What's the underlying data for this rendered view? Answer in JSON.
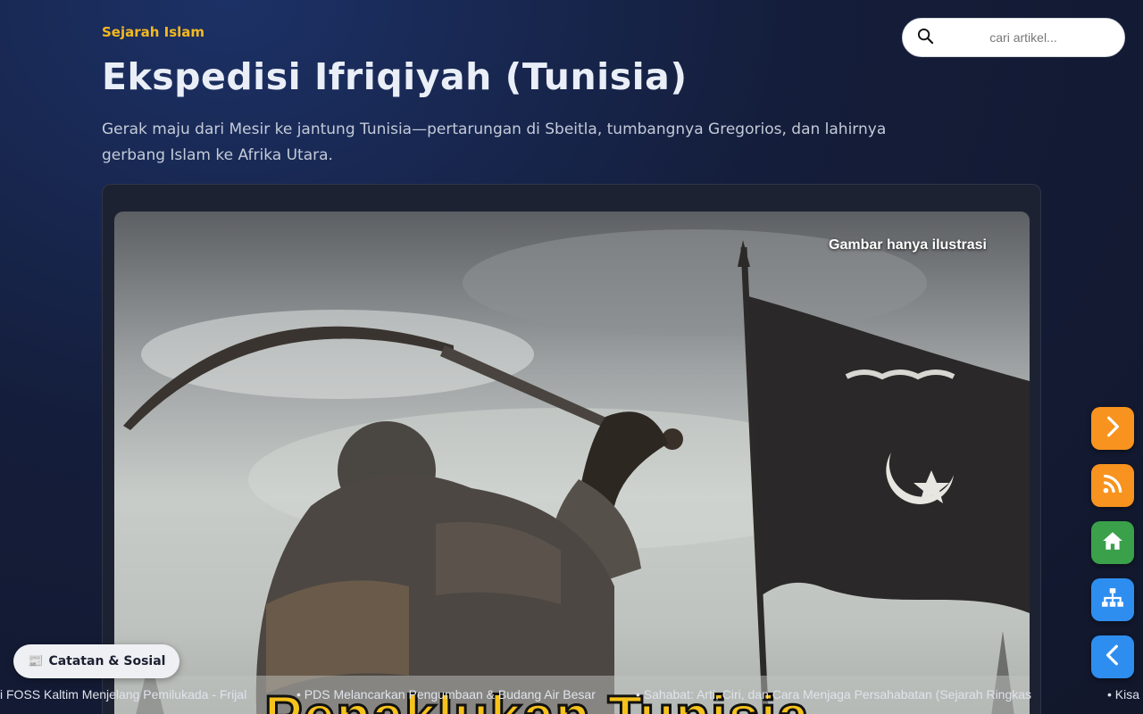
{
  "header": {
    "category": "Sejarah Islam",
    "title": "Ekspedisi Ifriqiyah (Tunisia)",
    "subtitle": "Gerak maju dari Mesir ke jantung Tunisia—pertarungan di Sbeitla, tumbangnya Gregorios, dan lahirnya gerbang Islam ke Afrika Utara."
  },
  "search": {
    "placeholder": "cari artikel..."
  },
  "hero": {
    "caption": "Gambar hanya ilustrasi",
    "overlay_title": "Penaklukan Tunisia"
  },
  "sidebar_buttons": [
    {
      "icon": "chevron-right-icon",
      "color": "#f7931e"
    },
    {
      "icon": "rss-icon",
      "color": "#f7931e"
    },
    {
      "icon": "home-icon",
      "color": "#3aa04a"
    },
    {
      "icon": "sitemap-icon",
      "color": "#2e8ef0"
    },
    {
      "icon": "chevron-left-icon",
      "color": "#2e8ef0"
    }
  ],
  "notes_button": {
    "icon": "newspaper-icon",
    "label": "Catatan & Sosial"
  },
  "ticker": {
    "items": [
      "i FOSS Kaltim Menjelang Pemilukada - Frijal",
      "• PDS Melancarkan Pengumbaan & Budang Air Besar",
      "• Sahabat: Arti, Ciri, dan Cara Menjaga Persahabatan (Sejarah Ringkas",
      "• Kisa"
    ]
  },
  "colors": {
    "accent": "#f5b81f",
    "background": "#141d3a"
  }
}
